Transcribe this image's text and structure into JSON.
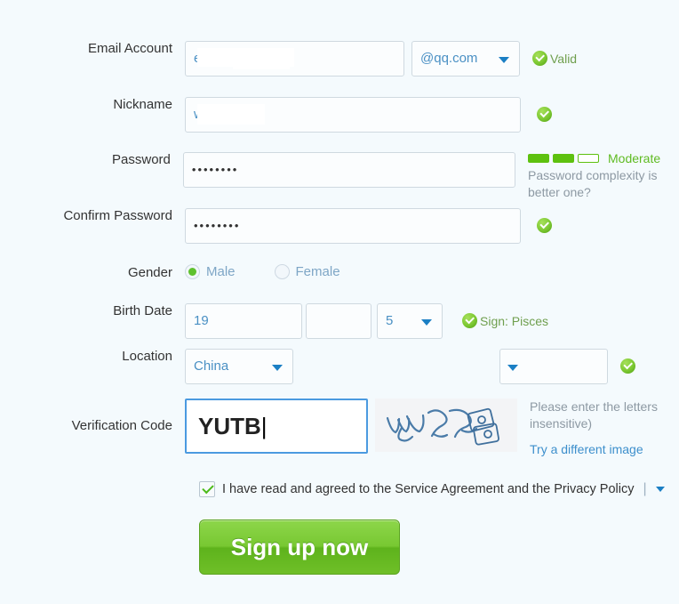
{
  "form": {
    "rows": {
      "email": {
        "label": "Email Account",
        "value": "e",
        "domain": "@qq.com",
        "status": "Valid"
      },
      "nickname": {
        "label": "Nickname",
        "value": "w"
      },
      "password": {
        "label": "Password",
        "value": "••••••••",
        "strength_label": "Moderate",
        "strength_filled": 2,
        "strength_total": 3,
        "note": "Password complexity is better one?"
      },
      "confirm_password": {
        "label": "Confirm Password",
        "value": "••••••••"
      },
      "gender": {
        "label": "Gender",
        "options": [
          "Male",
          "Female"
        ],
        "selected": "Male"
      },
      "birth_date": {
        "label": "Birth Date",
        "year": "19",
        "month": "",
        "day": "5",
        "sign": "Sign: Pisces"
      },
      "location": {
        "label": "Location",
        "country": "China"
      },
      "verification": {
        "label": "Verification Code",
        "value": "YUTB",
        "help": "Please enter the letters insensitive)",
        "refresh_link": "Try a different image"
      },
      "agreement": {
        "text": "I have read and agreed to the Service Agreement and the Privacy Policy",
        "separator": "|",
        "checked": true
      },
      "submit": {
        "label": "Sign up now"
      }
    }
  },
  "colors": {
    "page_bg": "#f4fafd",
    "accent_blue": "#4a90c4",
    "success_green": "#5fbb22",
    "button_green": "#78c832",
    "link_blue": "#3d8fcc"
  }
}
